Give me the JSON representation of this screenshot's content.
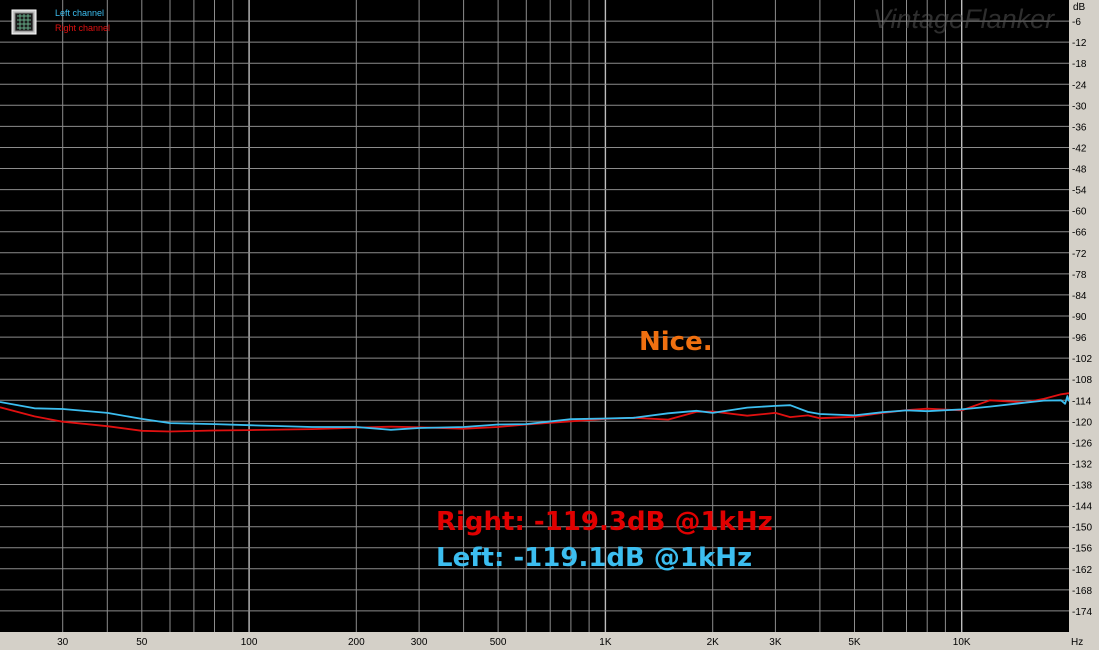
{
  "chart_data": {
    "type": "line",
    "xscale": "log",
    "xlim": [
      20,
      20000
    ],
    "ylim": [
      -180,
      0
    ],
    "ylabel": "dB",
    "xlabel": "Hz",
    "y_ticks": [
      -6,
      -12,
      -18,
      -24,
      -30,
      -36,
      -42,
      -48,
      -54,
      -60,
      -66,
      -72,
      -78,
      -84,
      -90,
      -96,
      -102,
      -108,
      -114,
      -120,
      -126,
      -132,
      -138,
      -144,
      -150,
      -156,
      -162,
      -168,
      -174
    ],
    "x_ticks": [
      {
        "value": 30,
        "label": "30"
      },
      {
        "value": 50,
        "label": "50"
      },
      {
        "value": 100,
        "label": "100"
      },
      {
        "value": 200,
        "label": "200"
      },
      {
        "value": 300,
        "label": "300"
      },
      {
        "value": 500,
        "label": "500"
      },
      {
        "value": 1000,
        "label": "1K"
      },
      {
        "value": 2000,
        "label": "2K"
      },
      {
        "value": 3000,
        "label": "3K"
      },
      {
        "value": 5000,
        "label": "5K"
      },
      {
        "value": 10000,
        "label": "10K"
      }
    ],
    "grid": true,
    "legend_position": "top-left",
    "series": [
      {
        "name": "Left channel",
        "color": "#3cbef0",
        "x": [
          20,
          25,
          30,
          40,
          50,
          60,
          80,
          100,
          150,
          200,
          250,
          300,
          400,
          500,
          600,
          800,
          1000,
          1200,
          1500,
          1800,
          2000,
          2500,
          3000,
          3300,
          3700,
          4000,
          5000,
          6000,
          7000,
          8000,
          10000,
          12000,
          15000,
          17000,
          19000,
          19500,
          19800,
          20000
        ],
        "y": [
          -114.5,
          -116.3,
          -116.5,
          -117.6,
          -119.3,
          -120.5,
          -120.8,
          -121.1,
          -121.6,
          -121.6,
          -122.4,
          -121.9,
          -121.6,
          -120.9,
          -120.8,
          -119.4,
          -119.2,
          -119.0,
          -117.7,
          -117.0,
          -117.6,
          -116.1,
          -115.6,
          -115.4,
          -117.3,
          -117.9,
          -118.3,
          -117.4,
          -116.9,
          -117.1,
          -116.6,
          -115.8,
          -114.7,
          -114.1,
          -114.0,
          -115.0,
          -112.8,
          -114.3
        ]
      },
      {
        "name": "Right channel",
        "color": "#e01010",
        "x": [
          20,
          25,
          30,
          40,
          50,
          60,
          80,
          100,
          150,
          200,
          250,
          300,
          400,
          500,
          600,
          800,
          1000,
          1200,
          1500,
          1800,
          2000,
          2500,
          3000,
          3300,
          3700,
          4000,
          5000,
          6000,
          7000,
          8000,
          10000,
          12000,
          15000,
          17000,
          19000,
          20000
        ],
        "y": [
          -116.0,
          -118.6,
          -120.1,
          -121.4,
          -122.7,
          -122.9,
          -122.6,
          -122.5,
          -122.2,
          -121.8,
          -121.5,
          -121.7,
          -122.1,
          -121.6,
          -120.9,
          -120.0,
          -119.3,
          -119.0,
          -119.5,
          -117.3,
          -117.2,
          -118.4,
          -117.6,
          -118.8,
          -118.3,
          -119.1,
          -118.7,
          -117.6,
          -116.8,
          -116.4,
          -116.9,
          -114.0,
          -114.6,
          -113.6,
          -112.3,
          -112.0
        ]
      }
    ]
  },
  "legend": {
    "left_label": "Left channel",
    "right_label": "Right channel"
  },
  "axis": {
    "y_unit": "dB",
    "x_unit": "Hz"
  },
  "watermark": "VintageFlanker",
  "annotations": {
    "nice": "Nice.",
    "right_result": "Right: -119.3dB @1kHz",
    "left_result": "Left: -119.1dB @1kHz",
    "nice_color": "#f07010",
    "right_color": "#e00000",
    "left_color": "#3cbef0"
  }
}
